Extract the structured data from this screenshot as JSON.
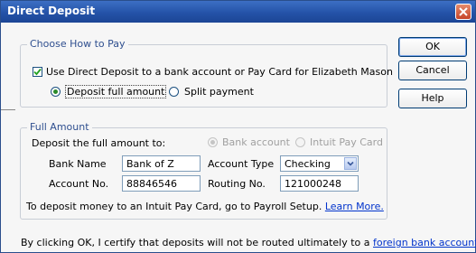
{
  "window": {
    "title": "Direct Deposit"
  },
  "choose": {
    "legend": "Choose How to Pay",
    "use_dd_checkbox_label": "Use Direct Deposit to a bank account or Pay Card for Elizabeth Mason",
    "use_dd_checked": true,
    "deposit_full_label": "Deposit full amount",
    "split_payment_label": "Split payment",
    "selected": "Deposit full amount"
  },
  "full_amount": {
    "legend": "Full Amount",
    "deposit_to_label": "Deposit the full amount to:",
    "bank_account_label": "Bank account",
    "pay_card_label": "Intuit Pay Card",
    "bank_name_label": "Bank Name",
    "bank_name_value": "Bank of Z",
    "account_type_label": "Account Type",
    "account_type_value": "Checking",
    "account_no_label": "Account No.",
    "account_no_value": "88846546",
    "routing_no_label": "Routing No.",
    "routing_no_value": "121000248",
    "paycard_info_text": "To deposit money to an Intuit Pay Card, go to Payroll Setup.",
    "learn_more_link": "Learn More."
  },
  "buttons": {
    "ok": "OK",
    "cancel": "Cancel",
    "help": "Help"
  },
  "footer": {
    "certify_text": "By clicking OK, I certify that deposits will not be routed ultimately to a",
    "foreign_link": "foreign bank account."
  }
}
